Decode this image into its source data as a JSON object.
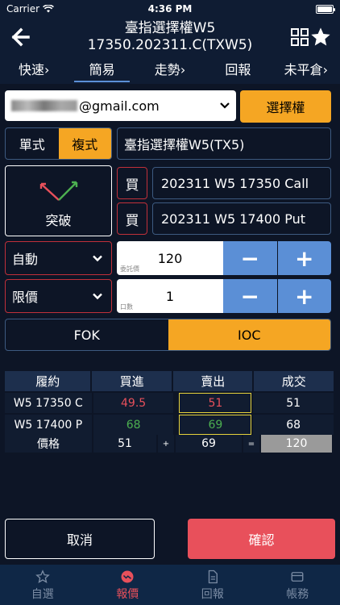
{
  "status": {
    "carrier": "Carrier",
    "time": "4:36 PM"
  },
  "header": {
    "title_line1": "臺指選擇權W5",
    "title_line2": "17350.202311.C(TXW5)"
  },
  "tabs": [
    {
      "label": "快速"
    },
    {
      "label": "簡易"
    },
    {
      "label": "走勢"
    },
    {
      "label": "回報"
    },
    {
      "label": "未平倉"
    }
  ],
  "account": {
    "email_suffix": "@gmail.com"
  },
  "choose_button": "選擇權",
  "order_mode": {
    "single": "單式",
    "combo": "複式"
  },
  "product": "臺指選擇權W5(TX5)",
  "strategy": {
    "label": "突破"
  },
  "legs": [
    {
      "side": "買",
      "contract": "202311 W5 17350 Call"
    },
    {
      "side": "買",
      "contract": "202311 W5 17400 Put"
    }
  ],
  "price_type": {
    "value": "自動"
  },
  "price": {
    "value": "120",
    "hint": "委託價"
  },
  "order_type": {
    "value": "限價"
  },
  "quantity": {
    "value": "1",
    "hint": "口數"
  },
  "stepper": {
    "minus": "−",
    "plus": "+"
  },
  "time_in_force": {
    "fok": "FOK",
    "ioc": "IOC"
  },
  "quote_table": {
    "headers": [
      "履約",
      "買進",
      "賣出",
      "成交"
    ],
    "rows": [
      {
        "strike": "W5 17350 C",
        "bid": "49.5",
        "ask": "51",
        "last": "51"
      },
      {
        "strike": "W5 17400 P",
        "bid": "68",
        "ask": "69",
        "last": "68"
      }
    ],
    "price_row": {
      "label": "價格",
      "a": "51",
      "op1": "+",
      "b": "69",
      "op2": "=",
      "total": "120"
    }
  },
  "actions": {
    "cancel": "取消",
    "confirm": "確認"
  },
  "bottom_nav": [
    {
      "label": "自選"
    },
    {
      "label": "報價"
    },
    {
      "label": "回報"
    },
    {
      "label": "帳務"
    }
  ],
  "colors": {
    "accent": "#f5a623",
    "sell": "#e8505b",
    "buy": "#4caf50",
    "stepper": "#5b8fd6"
  }
}
